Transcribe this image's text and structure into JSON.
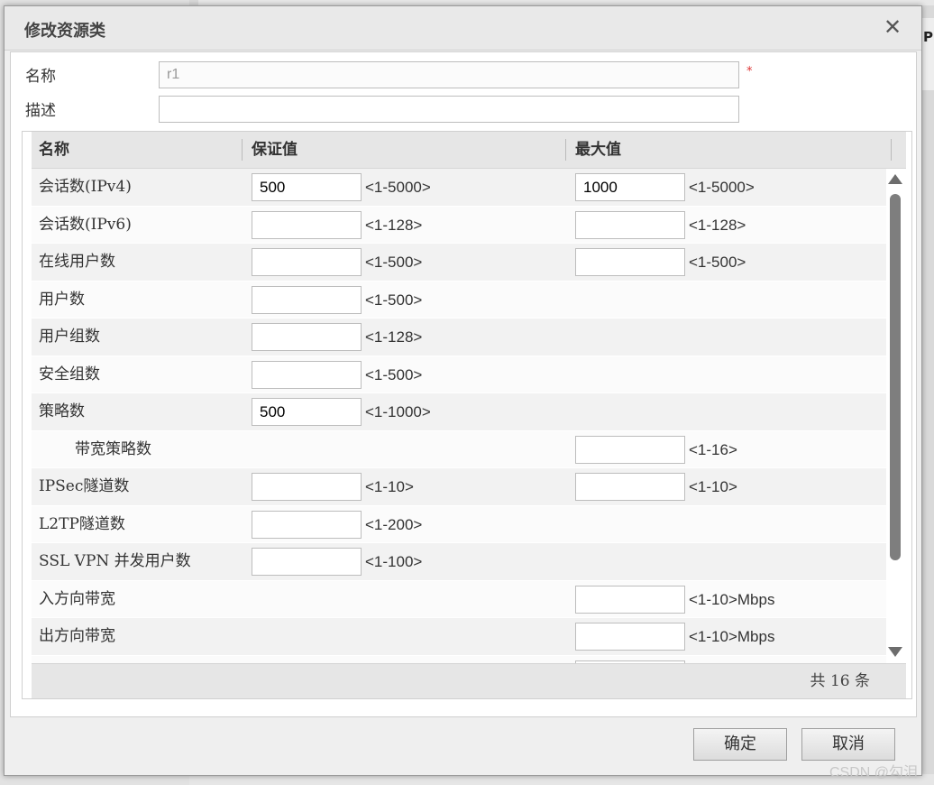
{
  "background": {
    "column_label": "P"
  },
  "dialog": {
    "title": "修改资源类",
    "close_glyph": "✕",
    "name_label": "名称",
    "name_value": "r1",
    "required_mark": "*",
    "desc_label": "描述",
    "desc_value": ""
  },
  "grid": {
    "headers": {
      "name": "名称",
      "guaranteed": "保证值",
      "max": "最大值"
    },
    "rows": [
      {
        "name": "会话数(IPv4)",
        "g_value": "500",
        "g_range": "<1-5000>",
        "m_value": "1000",
        "m_range": "<1-5000>"
      },
      {
        "name": "会话数(IPv6)",
        "g_value": "",
        "g_range": "<1-128>",
        "m_value": "",
        "m_range": "<1-128>"
      },
      {
        "name": "在线用户数",
        "g_value": "",
        "g_range": "<1-500>",
        "m_value": "",
        "m_range": "<1-500>"
      },
      {
        "name": "用户数",
        "g_value": "",
        "g_range": "<1-500>"
      },
      {
        "name": "用户组数",
        "g_value": "",
        "g_range": "<1-128>"
      },
      {
        "name": "安全组数",
        "g_value": "",
        "g_range": "<1-500>"
      },
      {
        "name": "策略数",
        "g_value": "500",
        "g_range": "<1-1000>"
      },
      {
        "name": "带宽策略数",
        "indent": true,
        "m_value": "",
        "m_range": "<1-16>"
      },
      {
        "name": "IPSec隧道数",
        "g_value": "",
        "g_range": "<1-10>",
        "m_value": "",
        "m_range": "<1-10>"
      },
      {
        "name": "L2TP隧道数",
        "g_value": "",
        "g_range": "<1-200>"
      },
      {
        "name": "SSL VPN 并发用户数",
        "g_value": "",
        "g_range": "<1-100>"
      },
      {
        "name": "入方向带宽",
        "m_value": "",
        "m_range": "<1-10>Mbps"
      },
      {
        "name": "出方向带宽",
        "m_value": "",
        "m_range": "<1-10>Mbps"
      },
      {
        "name": "",
        "m_value": ""
      }
    ],
    "total_text": "共 16 条"
  },
  "buttons": {
    "ok": "确定",
    "cancel": "取消"
  },
  "watermark": "CSDN @勾泪"
}
